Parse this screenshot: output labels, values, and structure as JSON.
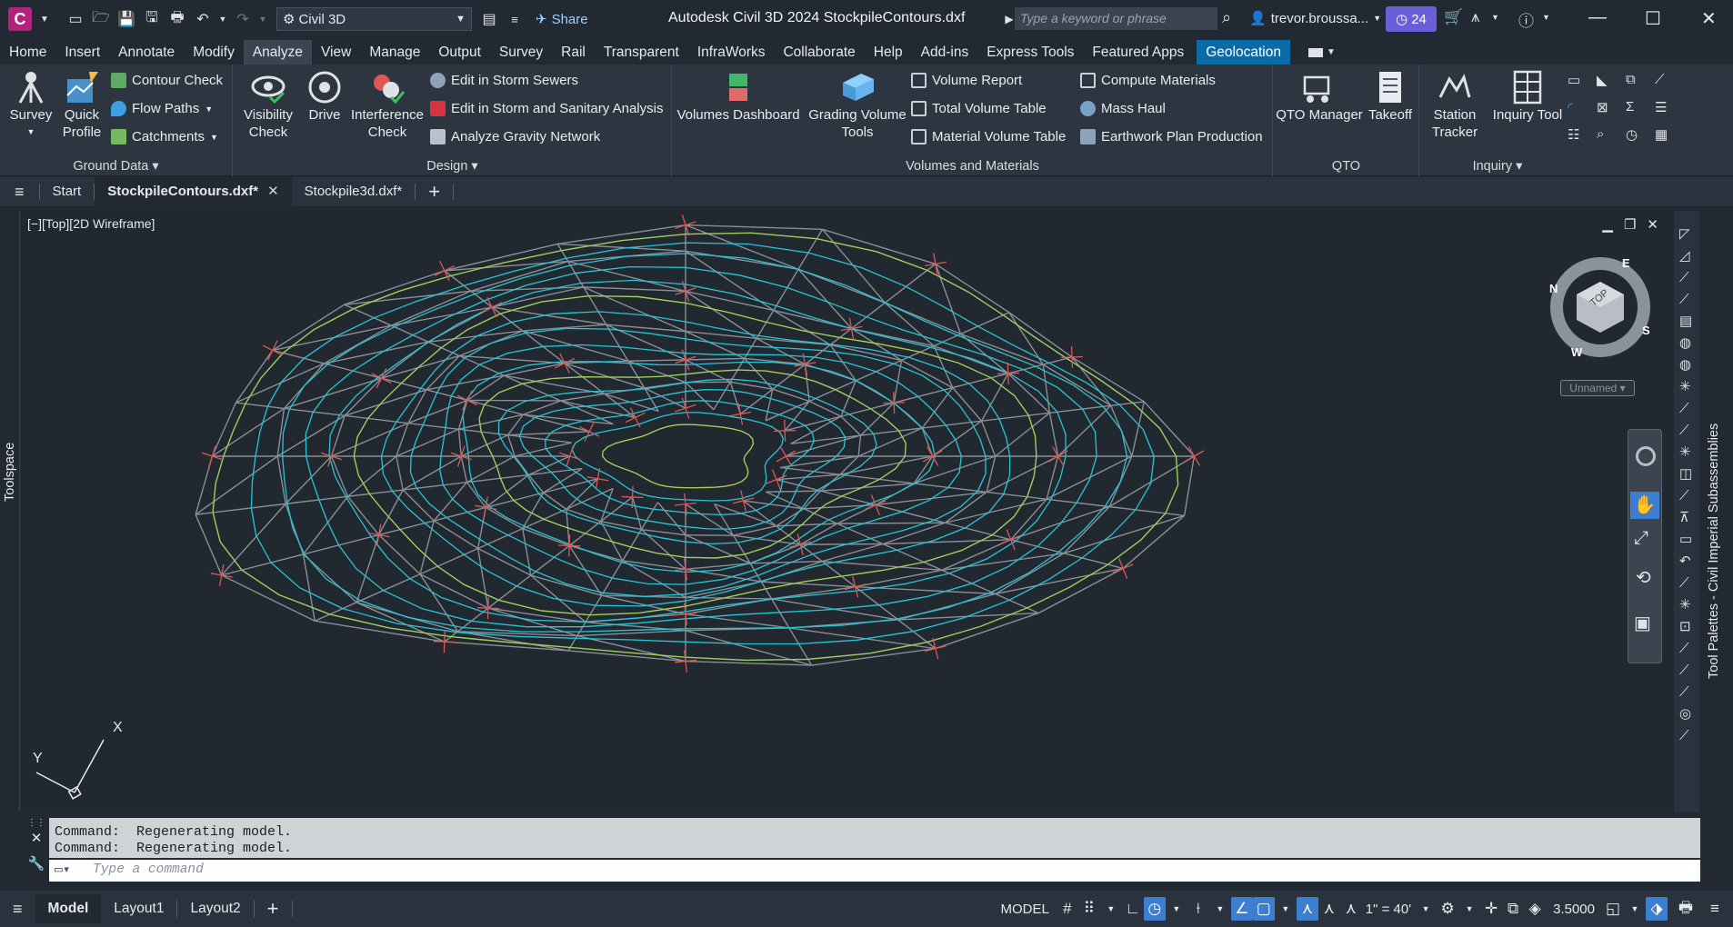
{
  "app": {
    "logo_letter": "C",
    "workspace": "Civil 3D",
    "share": "Share",
    "title": "Autodesk Civil 3D 2024    StockpileContours.dxf",
    "search_placeholder": "Type a keyword or phrase",
    "user": "trevor.broussa...",
    "clock_count": "24"
  },
  "menu": {
    "items": [
      "Home",
      "Insert",
      "Annotate",
      "Modify",
      "Analyze",
      "View",
      "Manage",
      "Output",
      "Survey",
      "Rail",
      "Transparent",
      "InfraWorks",
      "Collaborate",
      "Help",
      "Add-ins",
      "Express Tools",
      "Featured Apps"
    ],
    "active": "Analyze",
    "geolocation": "Geolocation"
  },
  "ribbon": {
    "ground_data": {
      "title": "Ground Data",
      "survey": "Survey",
      "quick_profile_1": "Quick",
      "quick_profile_2": "Profile",
      "contour_check": "Contour Check",
      "flow_paths": "Flow Paths",
      "catchments": "Catchments"
    },
    "design": {
      "title": "Design",
      "visibility_1": "Visibility",
      "visibility_2": "Check",
      "drive": "Drive",
      "interference_1": "Interference",
      "interference_2": "Check",
      "storm_sewers": "Edit in Storm Sewers",
      "storm_sanitary": "Edit in Storm and Sanitary Analysis",
      "gravity_network": "Analyze Gravity Network"
    },
    "volumes": {
      "title": "Volumes and Materials",
      "volumes_dashboard": "Volumes Dashboard",
      "grading_1": "Grading Volume",
      "grading_2": "Tools",
      "volume_report": "Volume Report",
      "total_volume_table": "Total Volume Table",
      "material_volume_table": "Material Volume Table",
      "compute_materials": "Compute Materials",
      "mass_haul": "Mass Haul",
      "earthwork": "Earthwork Plan Production"
    },
    "qto": {
      "title": "QTO",
      "qto_manager": "QTO Manager",
      "takeoff": "Takeoff"
    },
    "inquiry": {
      "title": "Inquiry",
      "station_1": "Station",
      "station_2": "Tracker",
      "inquiry_tool": "Inquiry Tool"
    }
  },
  "doc_tabs": {
    "start": "Start",
    "tab1": "StockpileContours.dxf*",
    "tab2": "Stockpile3d.dxf*"
  },
  "viewport": {
    "label": "[−][Top][2D Wireframe]",
    "viewcube_top": "TOP",
    "compass_n": "N",
    "compass_e": "E",
    "compass_s": "S",
    "compass_w": "W",
    "ucs_name": "Unnamed",
    "axis_x": "X",
    "axis_y": "Y"
  },
  "side": {
    "toolspace": "Toolspace",
    "palette": "Tool Palettes - Civil Imperial Subassemblies"
  },
  "command": {
    "line1": "Command:  Regenerating model.",
    "line2": "Command:  Regenerating model.",
    "placeholder": "Type a command"
  },
  "status": {
    "model": "Model",
    "layout1": "Layout1",
    "layout2": "Layout2",
    "model_space": "MODEL",
    "scale": "1\" = 40'",
    "elevation": "3.5000"
  },
  "colors": {
    "background": "#212830",
    "contour_major": "#9fcf5a",
    "contour_minor": "#26c6d6",
    "tin_lines": "#8a8f96",
    "labels": "#e05656"
  }
}
